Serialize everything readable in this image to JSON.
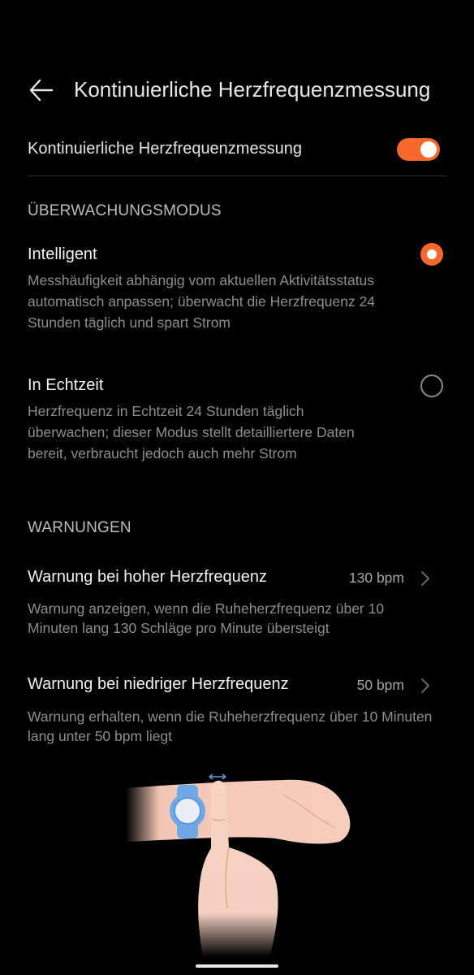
{
  "header": {
    "title": "Kontinuierliche Herzfrequenzmessung"
  },
  "continuous": {
    "label": "Kontinuierliche Herzfrequenzmessung",
    "enabled": true
  },
  "monitoring": {
    "section_title": "ÜBERWACHUNGSMODUS",
    "options": [
      {
        "title": "Intelligent",
        "description": "Messhäufigkeit abhängig vom aktuellen Aktivitätsstatus automatisch anpassen; überwacht die Herzfrequenz 24 Stunden täglich und spart Strom",
        "selected": true
      },
      {
        "title": "In Echtzeit",
        "description": "Herzfrequenz in Echtzeit 24 Stunden täglich überwachen; dieser Modus stellt detailliertere Daten bereit, verbraucht jedoch auch mehr Strom",
        "selected": false
      }
    ]
  },
  "warnings": {
    "section_title": "WARNUNGEN",
    "items": [
      {
        "label": "Warnung bei hoher Herzfrequenz",
        "value": "130 bpm",
        "description": "Warnung anzeigen, wenn die Ruheherzfrequenz über 10 Minuten lang 130 Schläge pro Minute übersteigt"
      },
      {
        "label": "Warnung bei niedriger Herzfrequenz",
        "value": "50 bpm",
        "description": "Warnung erhalten, wenn die Ruheherzfrequenz über 10 Minuten lang unter 50 bpm liegt"
      }
    ]
  },
  "colors": {
    "accent": "#f6692a",
    "background": "#000000",
    "watch": "#6fa8e6"
  },
  "icons": {
    "back": "arrow-left-icon",
    "chevron": "chevron-right-icon",
    "illustration": "wrist-watch-illustration"
  }
}
